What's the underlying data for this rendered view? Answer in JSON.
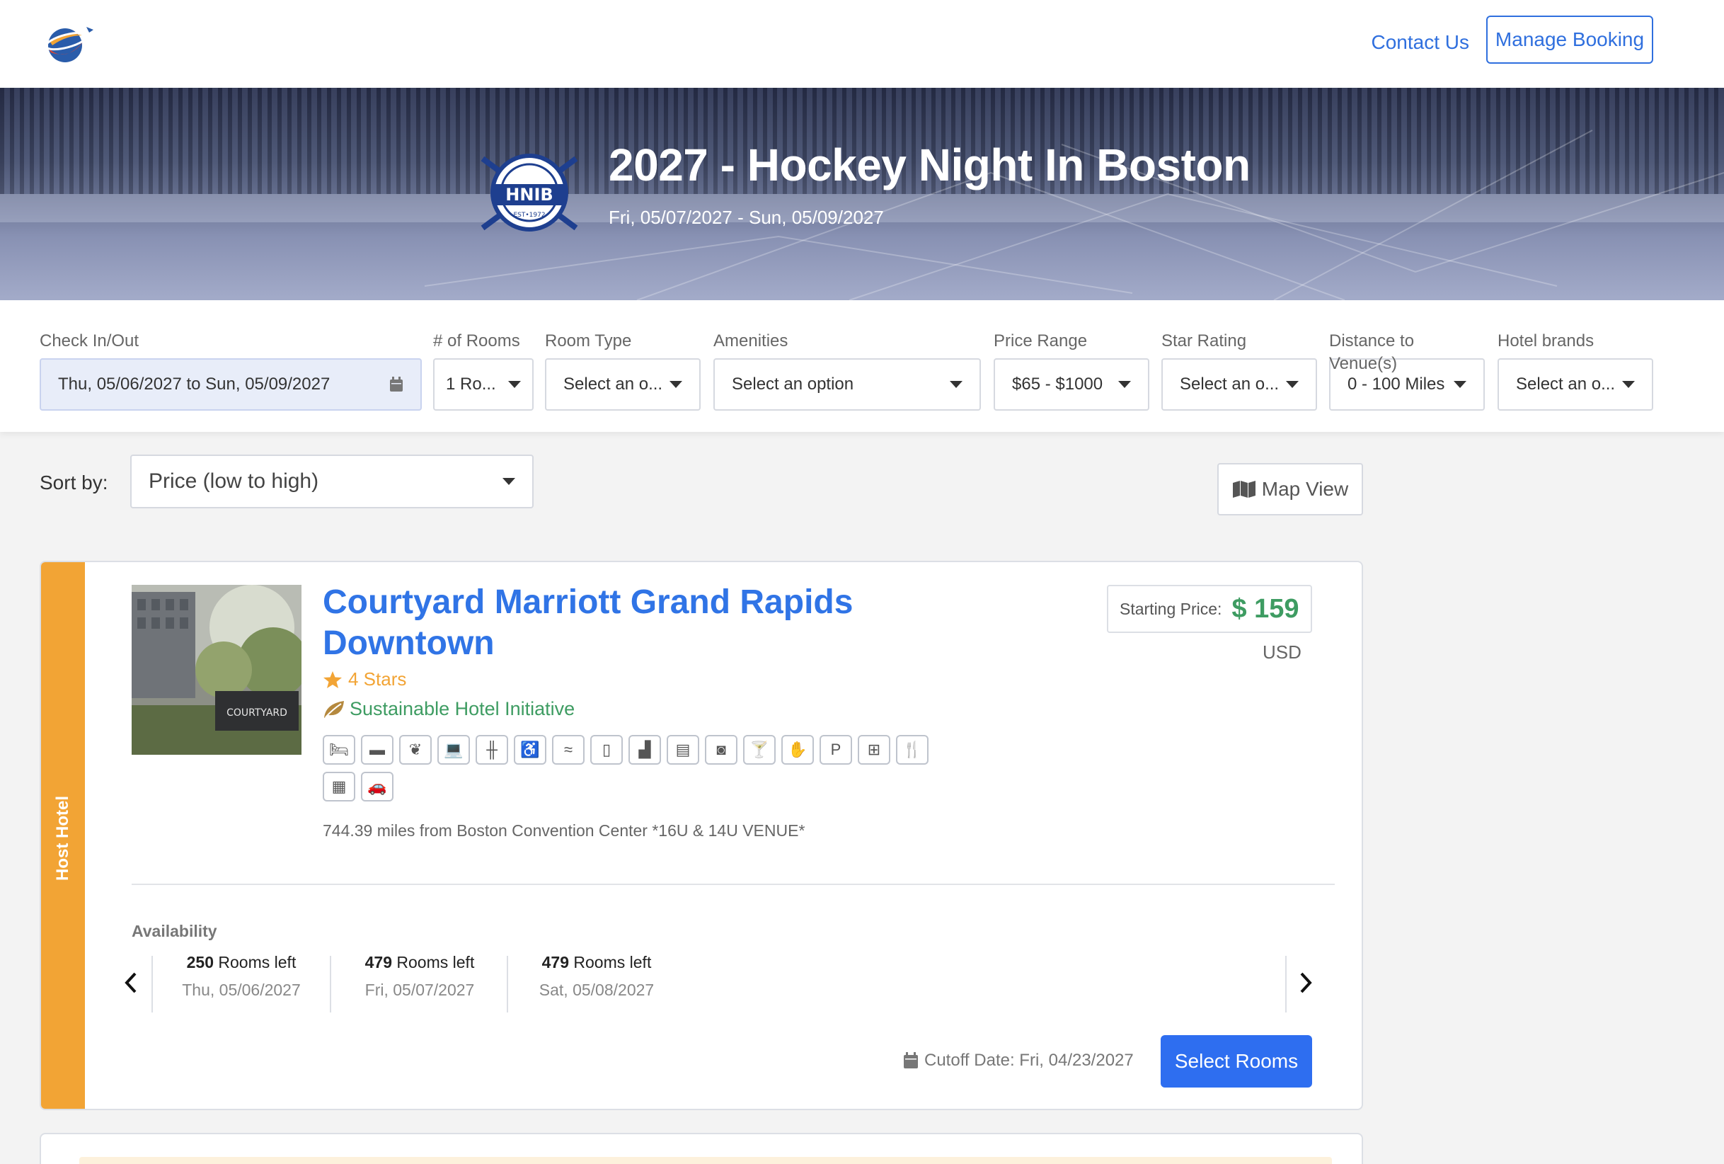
{
  "header": {
    "contact_label": "Contact Us",
    "manage_label": "Manage Booking"
  },
  "event": {
    "title": "2027 - Hockey Night In Boston",
    "dates": "Fri, 05/07/2027 - Sun, 05/09/2027",
    "logo_text": "HNIB",
    "logo_sub": "EST•1972",
    "logo_ring": "HOCKEY NIGHT IN BOSTON"
  },
  "filters": {
    "checkinout": {
      "label": "Check In/Out",
      "value": "Thu, 05/06/2027 to Sun, 05/09/2027"
    },
    "rooms": {
      "label": "# of Rooms",
      "value": "1 Ro..."
    },
    "room_type": {
      "label": "Room Type",
      "value": "Select an o..."
    },
    "amenities": {
      "label": "Amenities",
      "value": "Select an option"
    },
    "price_range": {
      "label": "Price Range",
      "value": "$65 - $1000"
    },
    "star_rating": {
      "label": "Star Rating",
      "value": "Select an o..."
    },
    "distance": {
      "label": "Distance to Venue(s)",
      "value": "0 - 100 Miles"
    },
    "brands": {
      "label": "Hotel brands",
      "value": "Select an o..."
    }
  },
  "sort": {
    "label": "Sort by:",
    "value": "Price (low to high)"
  },
  "map_view_label": "Map View",
  "hotel": {
    "badge": "Host Hotel",
    "name": "Courtyard Marriott Grand Rapids Downtown",
    "image_sign": "COURTYARD",
    "stars": "4 Stars",
    "sustainability": "Sustainable Hotel Initiative",
    "amenity_icons": [
      "bed-icon",
      "wallet-icon",
      "leaf-icon",
      "laptop-icon",
      "dumbbell-icon",
      "wheelchair-icon",
      "pool-icon",
      "fridge-icon",
      "hairdryer-icon",
      "microwave-icon",
      "laundry-icon",
      "bar-icon",
      "handshake-icon",
      "parking-icon",
      "network-icon",
      "restaurant-icon",
      "luggage-icon",
      "shuttle-icon"
    ],
    "distance": "744.39 miles from Boston Convention Center *16U & 14U VENUE*",
    "price_label": "Starting Price:",
    "price": "$ 159",
    "currency": "USD",
    "availability_label": "Availability",
    "availability": [
      {
        "count": "250",
        "suffix": " Rooms left",
        "date": "Thu, 05/06/2027"
      },
      {
        "count": "479",
        "suffix": " Rooms left",
        "date": "Fri, 05/07/2027"
      },
      {
        "count": "479",
        "suffix": " Rooms left",
        "date": "Sat, 05/08/2027"
      }
    ],
    "cutoff": "Cutoff Date: Fri, 04/23/2027",
    "select_label": "Select Rooms"
  },
  "colors": {
    "brand_blue": "#3074e6",
    "button_blue": "#2e6ef0",
    "host_orange": "#f2a435",
    "price_green": "#3e9c62"
  }
}
